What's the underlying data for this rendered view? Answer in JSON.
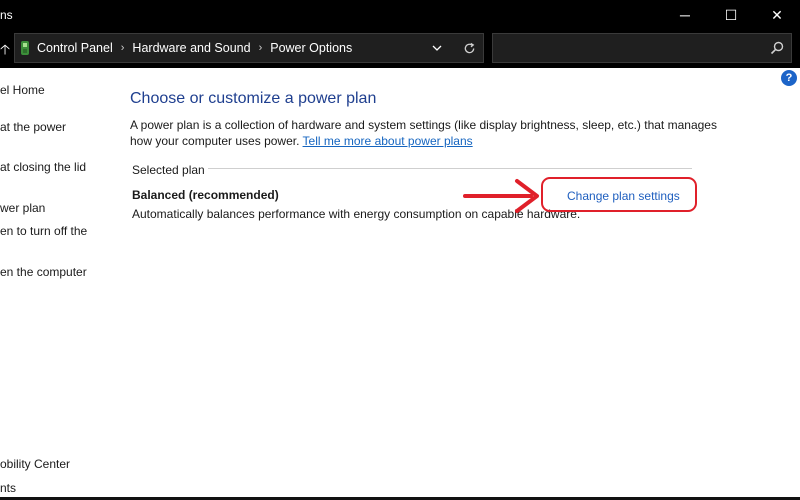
{
  "window": {
    "title_partial": "ns",
    "controls": {
      "minimize": "─",
      "maximize": "☐",
      "close": "✕"
    }
  },
  "addressbar": {
    "up_arrow": "🡡",
    "breadcrumbs": [
      "Control Panel",
      "Hardware and Sound",
      "Power Options"
    ],
    "separator": "›",
    "search_placeholder": ""
  },
  "sidebar": {
    "items": [
      "el Home",
      "at the power",
      "at closing the lid",
      "wer plan",
      "en to turn off the",
      "en the computer",
      "obility Center",
      "nts"
    ]
  },
  "main": {
    "help_label": "?",
    "title": "Choose or customize a power plan",
    "description": "A power plan is a collection of hardware and system settings (like display brightness, sleep, etc.) that manages how your computer uses power.",
    "learn_more_link": "Tell me more about power plans",
    "selected_plan_label": "Selected plan",
    "plan": {
      "name": "Balanced (recommended)",
      "description": "Automatically balances performance with energy consumption on capable hardware.",
      "change_settings_link": "Change plan settings"
    }
  },
  "colors": {
    "titlebar_bg": "#000000",
    "title_blue": "#1f3f8f",
    "link_blue": "#1565c0",
    "annotation_red": "#e0202a",
    "help_blue": "#1c64c8"
  },
  "icons": {
    "control_panel": "control-panel-icon",
    "dropdown": "chevron-down-icon",
    "refresh": "refresh-icon",
    "search": "search-icon",
    "help": "help-icon"
  }
}
